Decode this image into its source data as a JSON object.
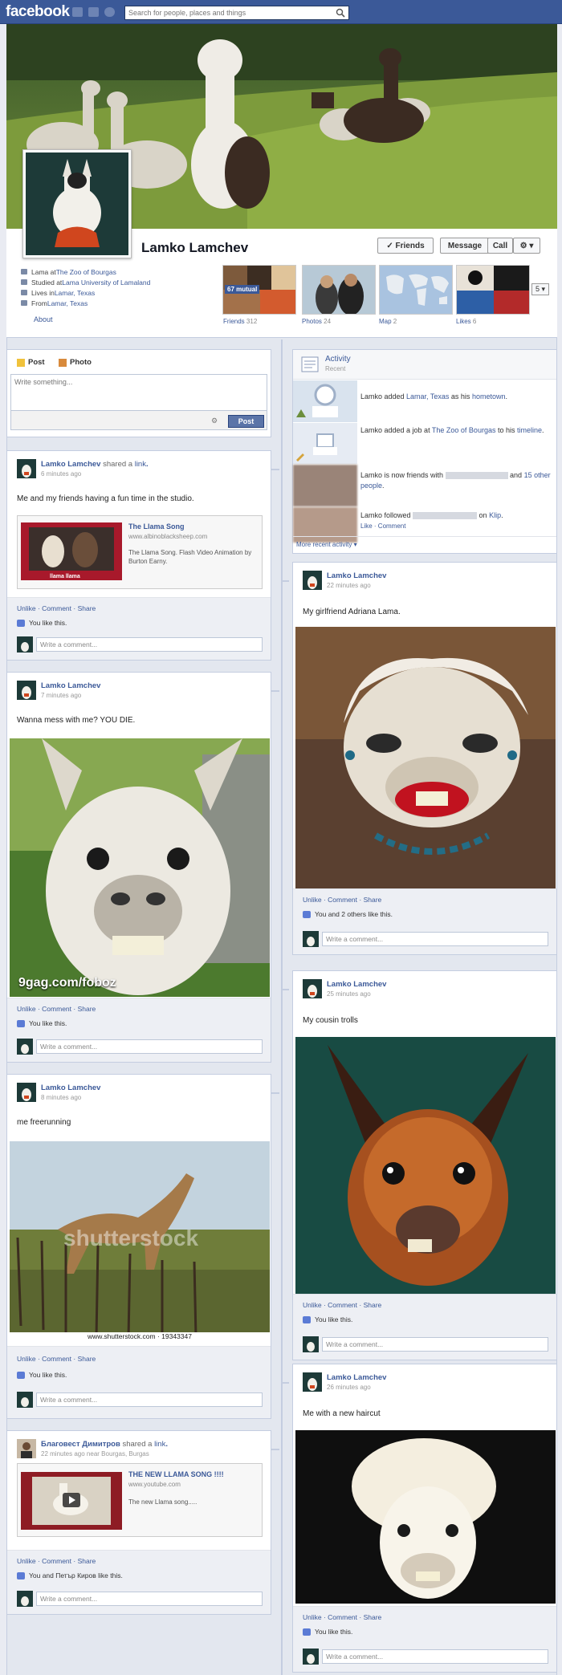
{
  "header": {
    "logo": "facebook",
    "search_placeholder": "Search for people, places and things"
  },
  "profile": {
    "name": "Lamko Lamchev",
    "buttons": {
      "friends": "✓ Friends",
      "message": "Message",
      "call": "Call",
      "gear": "⚙ ▾"
    },
    "info": [
      {
        "prefix": "Lama at ",
        "link": "The Zoo of Bourgas"
      },
      {
        "prefix": "Studied at ",
        "link": "Lama University of Lamaland"
      },
      {
        "prefix": "Lives in ",
        "link": "Lamar, Texas"
      },
      {
        "prefix": "From ",
        "link": "Lamar, Texas"
      }
    ],
    "about": "About",
    "tiles": [
      {
        "label": "Friends",
        "count": "312",
        "badge": "67 mutual"
      },
      {
        "label": "Photos",
        "count": "24"
      },
      {
        "label": "Map",
        "count": "2"
      },
      {
        "label": "Likes",
        "count": "6"
      }
    ],
    "expand": "5 ▾"
  },
  "composer": {
    "tab_post": "Post",
    "tab_photo": "Photo",
    "placeholder": "Write something...",
    "post_button": "Post"
  },
  "activity": {
    "title": "Activity",
    "subtitle": "Recent",
    "items": [
      {
        "t1": "Lamko added ",
        "l1": "Lamar, Texas",
        "t2": " as his ",
        "l2": "hometown",
        "t3": "."
      },
      {
        "t1": "Lamko added a job at ",
        "l1": "The Zoo of Bourgas",
        "t2": " to his ",
        "l2": "timeline",
        "t3": "."
      },
      {
        "t1": "Lamko is now friends with ",
        "t2": " and ",
        "l2": "15 other people",
        "t3": "."
      },
      {
        "t1": "Lamko followed ",
        "t2": " on ",
        "l2": "Klip",
        "t3": ".",
        "actions": "Like · Comment"
      }
    ],
    "more": "More recent activity ▾"
  },
  "common": {
    "actions_unlike": "Unlike · Comment · Share",
    "you_like": "You like this.",
    "write_comment": "Write a comment..."
  },
  "posts": {
    "p1": {
      "author": "Lamko Lamchev",
      "verb": " shared a ",
      "verb_link": "link",
      "time": "6 minutes ago",
      "text": "Me and my friends having a fun time in the studio.",
      "link_title": "The Llama Song",
      "link_url": "www.albinoblacksheep.com",
      "link_desc": "The Llama Song. Flash Video Animation by Burton Earny.",
      "thumb_caption": "llama llama"
    },
    "p2": {
      "author": "Lamko Lamchev",
      "time": "7 minutes ago",
      "text": "Wanna mess with me? YOU DIE.",
      "watermark": "9gag.com/foboz"
    },
    "p3": {
      "author": "Lamko Lamchev",
      "time": "8 minutes ago",
      "text": "me freerunning",
      "watermark": "shutterstock",
      "caption": "www.shutterstock.com · 19343347"
    },
    "p4": {
      "author": "Благовест Димитров",
      "verb": " shared a ",
      "verb_link": "link",
      "time": "22 minutes ago near Bourgas, Burgas",
      "link_title": "THE NEW LLAMA SONG !!!!",
      "link_url": "www.youtube.com",
      "link_desc": "The new Llama song.....",
      "likes": "You and Петър Киров like this."
    },
    "r1": {
      "author": "Lamko Lamchev",
      "time": "22 minutes ago",
      "text": "My girlfriend Adriana Lama.",
      "likes": "You and 2 others like this."
    },
    "r2": {
      "author": "Lamko Lamchev",
      "time": "25 minutes ago",
      "text": "My cousin trolls"
    },
    "r3": {
      "author": "Lamko Lamchev",
      "time": "26 minutes ago",
      "text": "Me with a new haircut"
    }
  },
  "colors": {
    "brand": "#3b5998",
    "background": "#e9ebf2",
    "card_border": "#c4cde0",
    "footer": "#edeff4"
  }
}
